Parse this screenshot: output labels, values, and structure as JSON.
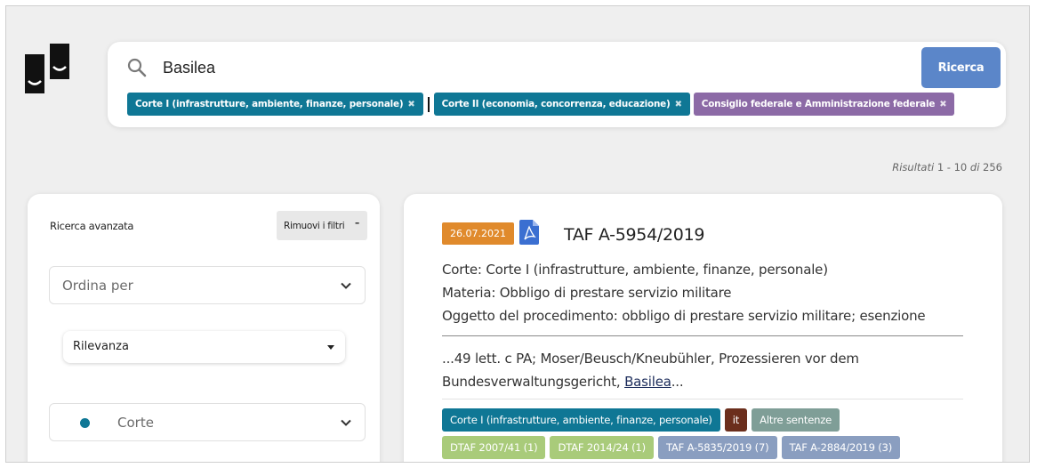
{
  "search": {
    "query": "Basilea",
    "button_label": "Ricerca",
    "chips": [
      {
        "label": "Corte I (infrastrutture, ambiente, finanze, personale)",
        "color": "#0f7795"
      },
      {
        "label": "Corte II (economia, concorrenza, educazione)",
        "color": "#0f7795"
      },
      {
        "label": "Consiglio federale e Amministrazione federale",
        "color": "#8c6aa6"
      }
    ],
    "chip_remove_glyph": "✖"
  },
  "results": {
    "label": "Risultati",
    "range": "1 - 10",
    "of_label": "di",
    "total": "256"
  },
  "sidebar": {
    "title": "Ricerca avanzata",
    "remove_filters_label": "Rimuovi i filtri",
    "remove_filters_glyph": "–",
    "order_label": "Ordina per",
    "order_value": "Rilevanza",
    "court_label": "Corte",
    "court_dot_color": "#0f7795"
  },
  "result": {
    "date": "26.07.2021",
    "date_color": "#e08a2c",
    "title": "TAF A-5954/2019",
    "court_line": "Corte: Corte I (infrastrutture, ambiente, finanze, personale)",
    "subject_line": "Materia: Obbligo di prestare servizio militare",
    "object_line": "Oggetto del procedimento: obbligo di prestare servizio militare; esenzione",
    "snippet_before": "...49 lett. c PA; Moser/Beusch/Kneubühler, Prozessieren vor dem Bundesverwaltungsgericht, ",
    "snippet_highlight": "Basilea",
    "snippet_after": "...",
    "tags_row1": [
      {
        "label": "Corte I (infrastrutture, ambiente, finanze, personale)",
        "color": "#0f7795"
      },
      {
        "label": "it",
        "color": "#6b2e1c"
      },
      {
        "label": "Altre sentenze",
        "color": "#7f9e97"
      }
    ],
    "tags_row2": [
      {
        "label": "DTAF 2007/41 (1)",
        "color": "#a9cb7a"
      },
      {
        "label": "DTAF 2014/24 (1)",
        "color": "#a9cb7a"
      },
      {
        "label": "TAF A-5835/2019 (7)",
        "color": "#8a9ec0"
      },
      {
        "label": "TAF A-2884/2019 (3)",
        "color": "#8a9ec0"
      }
    ]
  },
  "icons": {
    "logo": "institution-logo",
    "search": "search-icon",
    "pdf": "pdf-icon",
    "chevron": "chevron-down-icon"
  }
}
